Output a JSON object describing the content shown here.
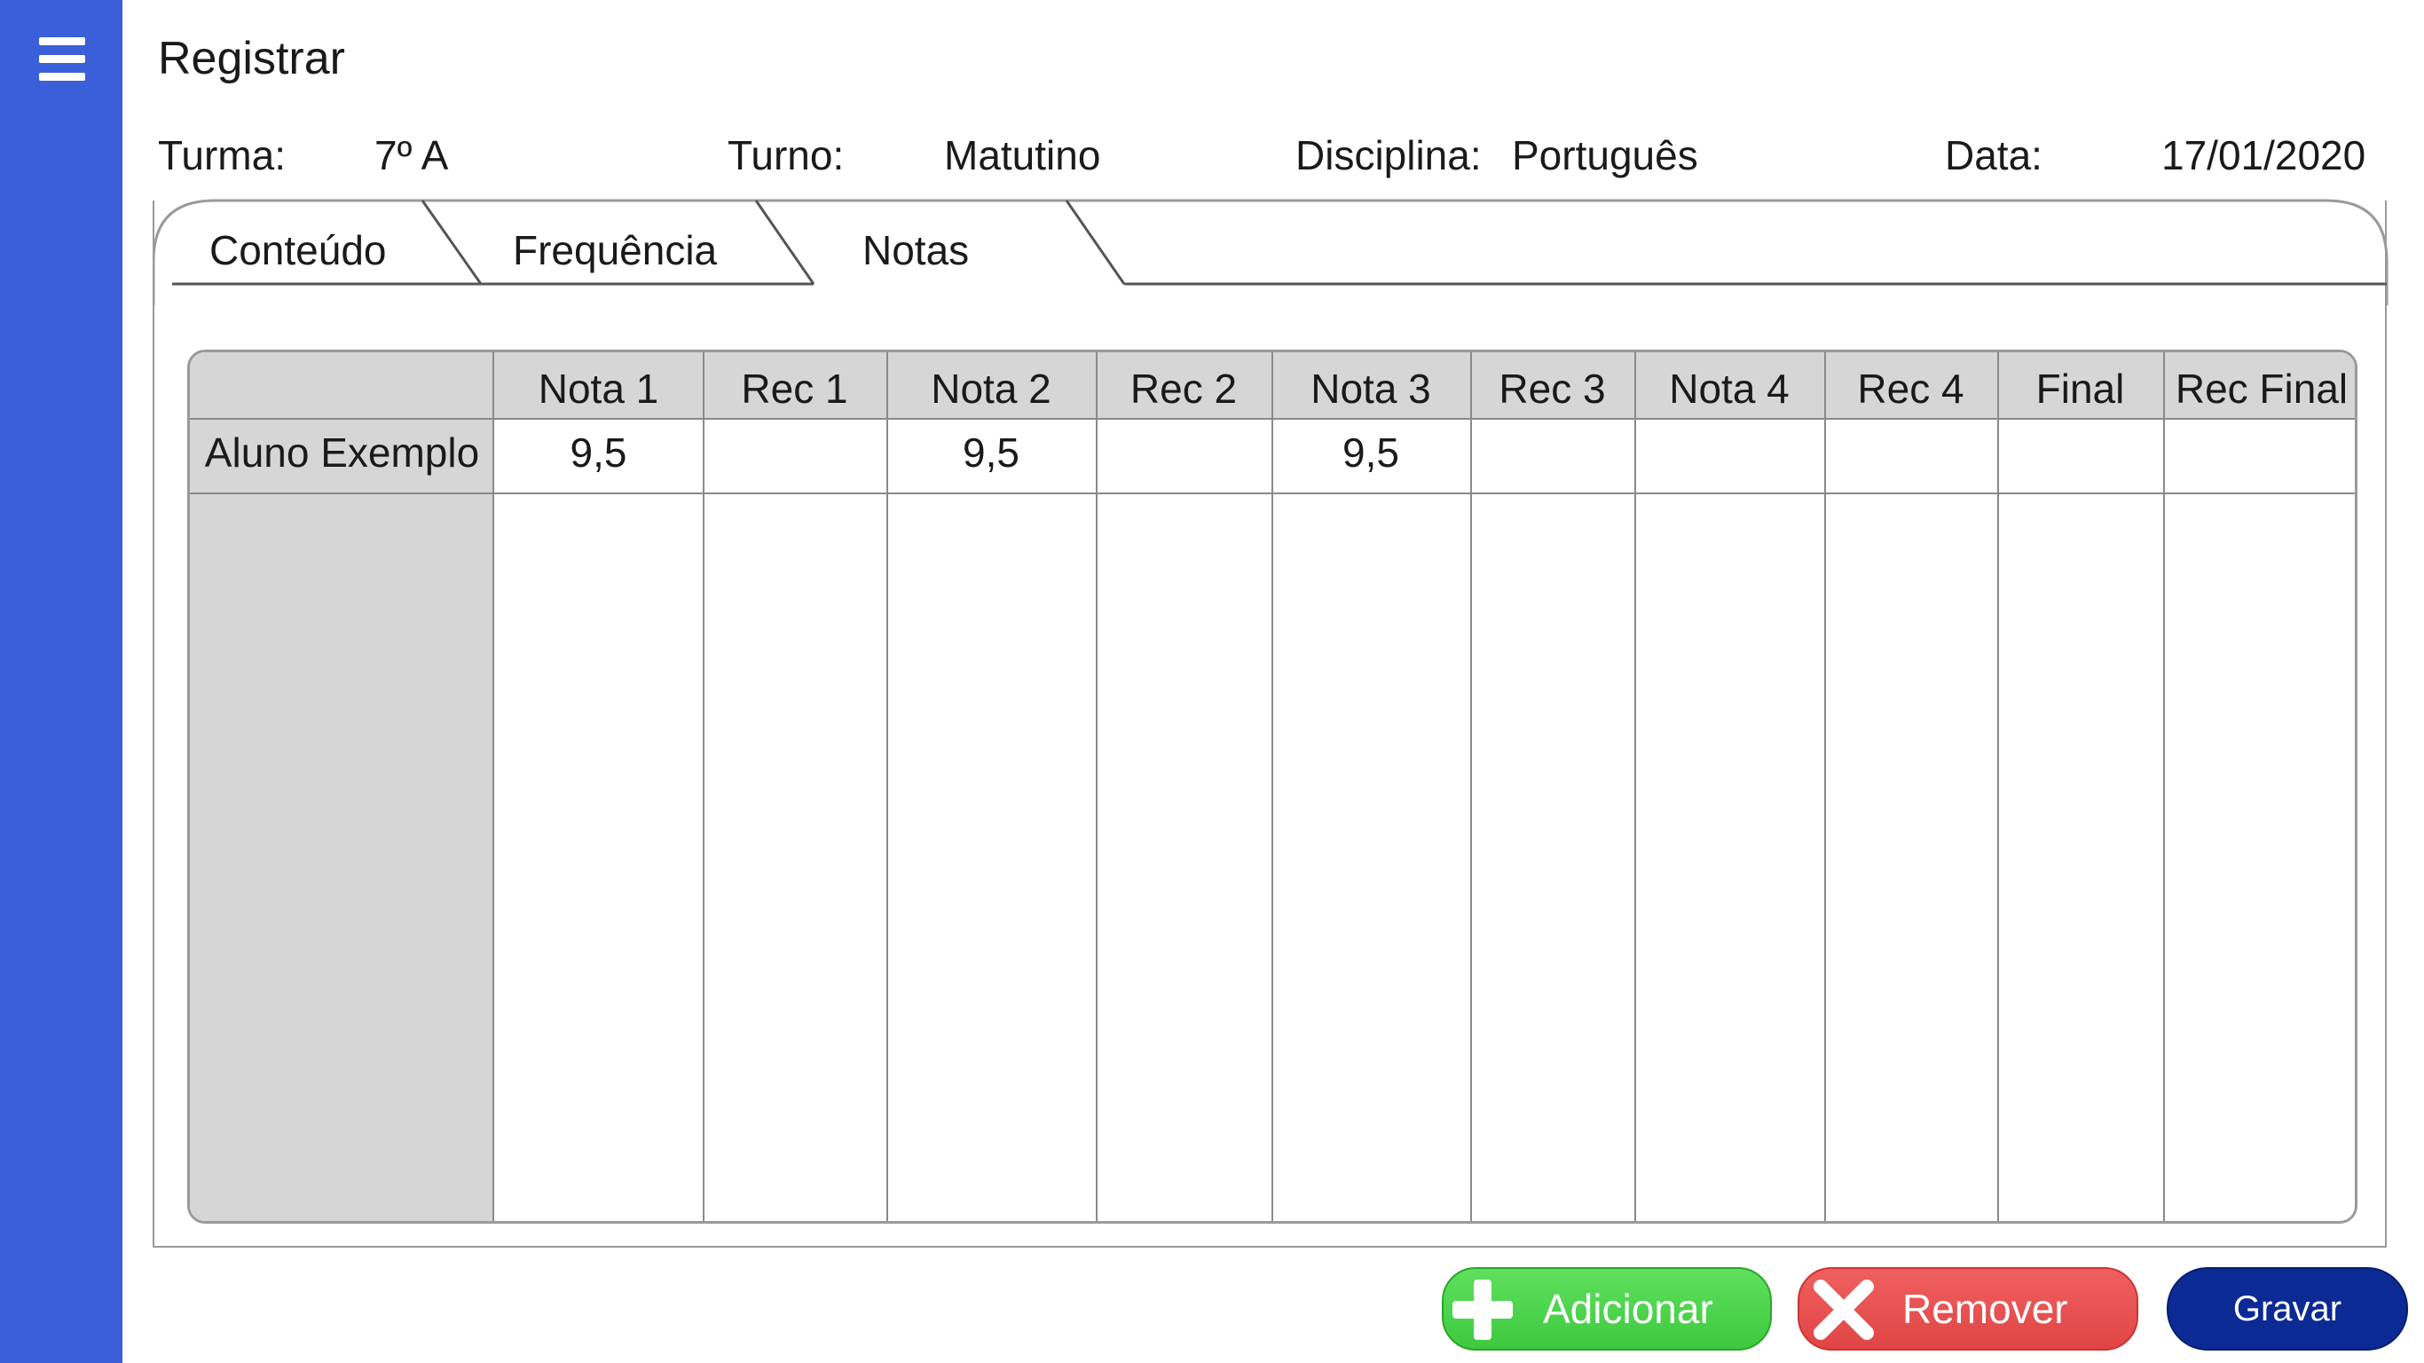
{
  "header": {
    "title": "Registrar"
  },
  "meta": {
    "turma_label": "Turma:",
    "turma_value": "7º A",
    "turno_label": "Turno:",
    "turno_value": "Matutino",
    "disciplina_label": "Disciplina:",
    "disciplina_value": "Português",
    "data_label": "Data:",
    "data_value": "17/01/2020"
  },
  "tabs": [
    {
      "label": "Conteúdo"
    },
    {
      "label": "Frequência"
    },
    {
      "label": "Notas",
      "active": true
    }
  ],
  "table": {
    "columns": [
      "Nota 1",
      "Rec 1",
      "Nota 2",
      "Rec 2",
      "Nota 3",
      "Rec 3",
      "Nota 4",
      "Rec 4",
      "Final",
      "Rec Final"
    ],
    "rows": [
      {
        "student": "Aluno Exemplo",
        "values": [
          "9,5",
          "",
          "9,5",
          "",
          "9,5",
          "",
          "",
          "",
          "",
          ""
        ]
      }
    ]
  },
  "buttons": {
    "add": "Adicionar",
    "remove": "Remover",
    "save": "Gravar"
  },
  "colors": {
    "sidebar": "#3a5fd9",
    "add": "#4cd94c",
    "remove": "#e84f4f",
    "save": "#0b2a94",
    "grid_header": "#d6d6d6"
  },
  "icons": {
    "menu": "hamburger-menu-icon",
    "add": "plus-icon",
    "remove": "x-icon"
  }
}
